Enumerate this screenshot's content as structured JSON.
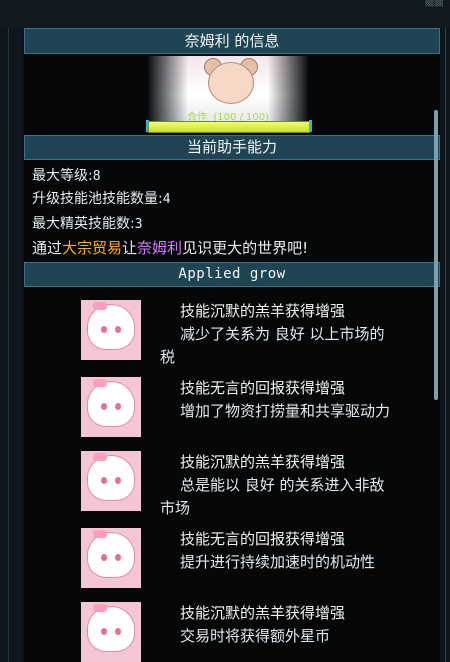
{
  "header": {
    "title": "奈姆利 的信息"
  },
  "cooperation": {
    "label": "合作",
    "value_text": "(100 / 100)",
    "progress": 1.0
  },
  "abilities": {
    "section_title": "当前助手能力",
    "max_level_label": "最大等级:",
    "max_level": "8",
    "pool_label": "升级技能池技能数量:",
    "pool": "4",
    "elite_label": "最大精英技能数:",
    "elite": "3",
    "tip": {
      "prefix": "通过",
      "trade": "大宗贸易",
      "mid": "让",
      "name": "奈姆利",
      "suffix": "见识更大的世界吧!"
    }
  },
  "grow": {
    "section_title": "Applied grow",
    "items": [
      {
        "title": "技能沉默的羔羊获得增强",
        "desc": "减少了关系为 良好 以上市场的",
        "desc2": "税"
      },
      {
        "title": "技能无言的回报获得增强",
        "desc": "增加了物资打捞量和共享驱动力",
        "desc2": ""
      },
      {
        "title": "技能沉默的羔羊获得增强",
        "desc": "总是能以 良好 的关系进入非敌",
        "desc2": "市场"
      },
      {
        "title": "技能无言的回报获得增强",
        "desc": "提升进行持续加速时的机动性",
        "desc2": ""
      },
      {
        "title": "技能沉默的羔羊获得增强",
        "desc": "交易时将获得额外星币",
        "desc2": ""
      }
    ]
  },
  "colors": {
    "accent_orange": "#ffb21f",
    "accent_purple": "#d77dff",
    "bar_green": "#c6e02a",
    "header_bg": "#1f4555"
  }
}
